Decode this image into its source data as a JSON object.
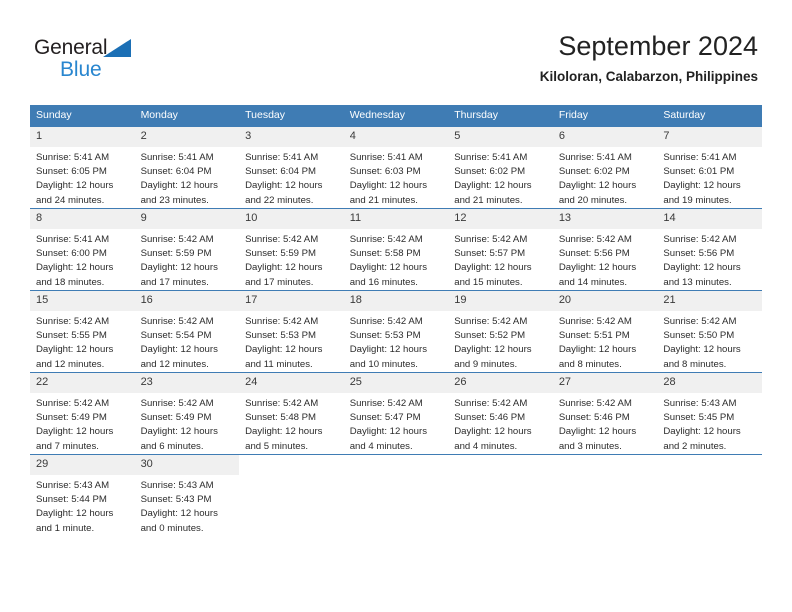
{
  "brand": {
    "name_top": "General",
    "name_bottom": "Blue",
    "triangle_color": "#1b6fb5",
    "top_color": "#231f20",
    "bottom_color": "#2986cf"
  },
  "header": {
    "title": "September 2024",
    "subtitle": "Kiloloran, Calabarzon, Philippines"
  },
  "theme": {
    "header_bg": "#3f7cb4",
    "header_text": "#ffffff",
    "daynum_bg": "#f0f0f0",
    "body_text": "#2c2c2c"
  },
  "weekdays": [
    "Sunday",
    "Monday",
    "Tuesday",
    "Wednesday",
    "Thursday",
    "Friday",
    "Saturday"
  ],
  "weeks": [
    [
      {
        "day": "1",
        "sunrise": "Sunrise: 5:41 AM",
        "sunset": "Sunset: 6:05 PM",
        "daylight1": "Daylight: 12 hours",
        "daylight2": "and 24 minutes."
      },
      {
        "day": "2",
        "sunrise": "Sunrise: 5:41 AM",
        "sunset": "Sunset: 6:04 PM",
        "daylight1": "Daylight: 12 hours",
        "daylight2": "and 23 minutes."
      },
      {
        "day": "3",
        "sunrise": "Sunrise: 5:41 AM",
        "sunset": "Sunset: 6:04 PM",
        "daylight1": "Daylight: 12 hours",
        "daylight2": "and 22 minutes."
      },
      {
        "day": "4",
        "sunrise": "Sunrise: 5:41 AM",
        "sunset": "Sunset: 6:03 PM",
        "daylight1": "Daylight: 12 hours",
        "daylight2": "and 21 minutes."
      },
      {
        "day": "5",
        "sunrise": "Sunrise: 5:41 AM",
        "sunset": "Sunset: 6:02 PM",
        "daylight1": "Daylight: 12 hours",
        "daylight2": "and 21 minutes."
      },
      {
        "day": "6",
        "sunrise": "Sunrise: 5:41 AM",
        "sunset": "Sunset: 6:02 PM",
        "daylight1": "Daylight: 12 hours",
        "daylight2": "and 20 minutes."
      },
      {
        "day": "7",
        "sunrise": "Sunrise: 5:41 AM",
        "sunset": "Sunset: 6:01 PM",
        "daylight1": "Daylight: 12 hours",
        "daylight2": "and 19 minutes."
      }
    ],
    [
      {
        "day": "8",
        "sunrise": "Sunrise: 5:41 AM",
        "sunset": "Sunset: 6:00 PM",
        "daylight1": "Daylight: 12 hours",
        "daylight2": "and 18 minutes."
      },
      {
        "day": "9",
        "sunrise": "Sunrise: 5:42 AM",
        "sunset": "Sunset: 5:59 PM",
        "daylight1": "Daylight: 12 hours",
        "daylight2": "and 17 minutes."
      },
      {
        "day": "10",
        "sunrise": "Sunrise: 5:42 AM",
        "sunset": "Sunset: 5:59 PM",
        "daylight1": "Daylight: 12 hours",
        "daylight2": "and 17 minutes."
      },
      {
        "day": "11",
        "sunrise": "Sunrise: 5:42 AM",
        "sunset": "Sunset: 5:58 PM",
        "daylight1": "Daylight: 12 hours",
        "daylight2": "and 16 minutes."
      },
      {
        "day": "12",
        "sunrise": "Sunrise: 5:42 AM",
        "sunset": "Sunset: 5:57 PM",
        "daylight1": "Daylight: 12 hours",
        "daylight2": "and 15 minutes."
      },
      {
        "day": "13",
        "sunrise": "Sunrise: 5:42 AM",
        "sunset": "Sunset: 5:56 PM",
        "daylight1": "Daylight: 12 hours",
        "daylight2": "and 14 minutes."
      },
      {
        "day": "14",
        "sunrise": "Sunrise: 5:42 AM",
        "sunset": "Sunset: 5:56 PM",
        "daylight1": "Daylight: 12 hours",
        "daylight2": "and 13 minutes."
      }
    ],
    [
      {
        "day": "15",
        "sunrise": "Sunrise: 5:42 AM",
        "sunset": "Sunset: 5:55 PM",
        "daylight1": "Daylight: 12 hours",
        "daylight2": "and 12 minutes."
      },
      {
        "day": "16",
        "sunrise": "Sunrise: 5:42 AM",
        "sunset": "Sunset: 5:54 PM",
        "daylight1": "Daylight: 12 hours",
        "daylight2": "and 12 minutes."
      },
      {
        "day": "17",
        "sunrise": "Sunrise: 5:42 AM",
        "sunset": "Sunset: 5:53 PM",
        "daylight1": "Daylight: 12 hours",
        "daylight2": "and 11 minutes."
      },
      {
        "day": "18",
        "sunrise": "Sunrise: 5:42 AM",
        "sunset": "Sunset: 5:53 PM",
        "daylight1": "Daylight: 12 hours",
        "daylight2": "and 10 minutes."
      },
      {
        "day": "19",
        "sunrise": "Sunrise: 5:42 AM",
        "sunset": "Sunset: 5:52 PM",
        "daylight1": "Daylight: 12 hours",
        "daylight2": "and 9 minutes."
      },
      {
        "day": "20",
        "sunrise": "Sunrise: 5:42 AM",
        "sunset": "Sunset: 5:51 PM",
        "daylight1": "Daylight: 12 hours",
        "daylight2": "and 8 minutes."
      },
      {
        "day": "21",
        "sunrise": "Sunrise: 5:42 AM",
        "sunset": "Sunset: 5:50 PM",
        "daylight1": "Daylight: 12 hours",
        "daylight2": "and 8 minutes."
      }
    ],
    [
      {
        "day": "22",
        "sunrise": "Sunrise: 5:42 AM",
        "sunset": "Sunset: 5:49 PM",
        "daylight1": "Daylight: 12 hours",
        "daylight2": "and 7 minutes."
      },
      {
        "day": "23",
        "sunrise": "Sunrise: 5:42 AM",
        "sunset": "Sunset: 5:49 PM",
        "daylight1": "Daylight: 12 hours",
        "daylight2": "and 6 minutes."
      },
      {
        "day": "24",
        "sunrise": "Sunrise: 5:42 AM",
        "sunset": "Sunset: 5:48 PM",
        "daylight1": "Daylight: 12 hours",
        "daylight2": "and 5 minutes."
      },
      {
        "day": "25",
        "sunrise": "Sunrise: 5:42 AM",
        "sunset": "Sunset: 5:47 PM",
        "daylight1": "Daylight: 12 hours",
        "daylight2": "and 4 minutes."
      },
      {
        "day": "26",
        "sunrise": "Sunrise: 5:42 AM",
        "sunset": "Sunset: 5:46 PM",
        "daylight1": "Daylight: 12 hours",
        "daylight2": "and 4 minutes."
      },
      {
        "day": "27",
        "sunrise": "Sunrise: 5:42 AM",
        "sunset": "Sunset: 5:46 PM",
        "daylight1": "Daylight: 12 hours",
        "daylight2": "and 3 minutes."
      },
      {
        "day": "28",
        "sunrise": "Sunrise: 5:43 AM",
        "sunset": "Sunset: 5:45 PM",
        "daylight1": "Daylight: 12 hours",
        "daylight2": "and 2 minutes."
      }
    ],
    [
      {
        "day": "29",
        "sunrise": "Sunrise: 5:43 AM",
        "sunset": "Sunset: 5:44 PM",
        "daylight1": "Daylight: 12 hours",
        "daylight2": "and 1 minute."
      },
      {
        "day": "30",
        "sunrise": "Sunrise: 5:43 AM",
        "sunset": "Sunset: 5:43 PM",
        "daylight1": "Daylight: 12 hours",
        "daylight2": "and 0 minutes."
      },
      {
        "day": "",
        "sunrise": "",
        "sunset": "",
        "daylight1": "",
        "daylight2": ""
      },
      {
        "day": "",
        "sunrise": "",
        "sunset": "",
        "daylight1": "",
        "daylight2": ""
      },
      {
        "day": "",
        "sunrise": "",
        "sunset": "",
        "daylight1": "",
        "daylight2": ""
      },
      {
        "day": "",
        "sunrise": "",
        "sunset": "",
        "daylight1": "",
        "daylight2": ""
      },
      {
        "day": "",
        "sunrise": "",
        "sunset": "",
        "daylight1": "",
        "daylight2": ""
      }
    ]
  ]
}
